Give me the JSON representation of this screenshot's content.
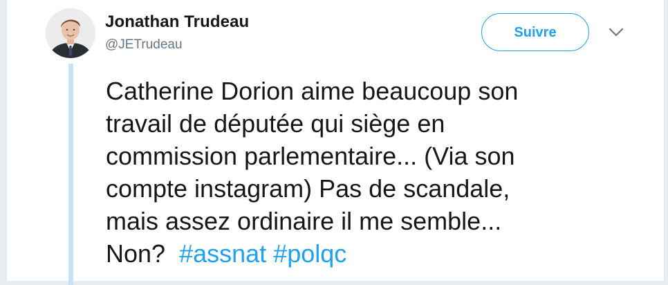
{
  "tweet": {
    "author_name": "Jonathan Trudeau",
    "author_handle": "@JETrudeau",
    "follow_label": "Suivre",
    "avatar_icon": "profile-photo",
    "more_icon": "chevron-down-icon",
    "text_lines": [
      "Catherine Dorion aime beaucoup son",
      "travail de députée qui siège en",
      "commission parlementaire... (Via son",
      "compte instagram) Pas de scandale,",
      "mais assez ordinaire il me semble..."
    ],
    "last_line_text": "Non?",
    "hashtags": [
      "#assnat",
      "#polqc"
    ]
  },
  "colors": {
    "accent": "#1da1f2",
    "text": "#14171a",
    "secondary_text": "#657786",
    "thread_line": "#c4e3f6",
    "background": "#e6ecf0"
  }
}
